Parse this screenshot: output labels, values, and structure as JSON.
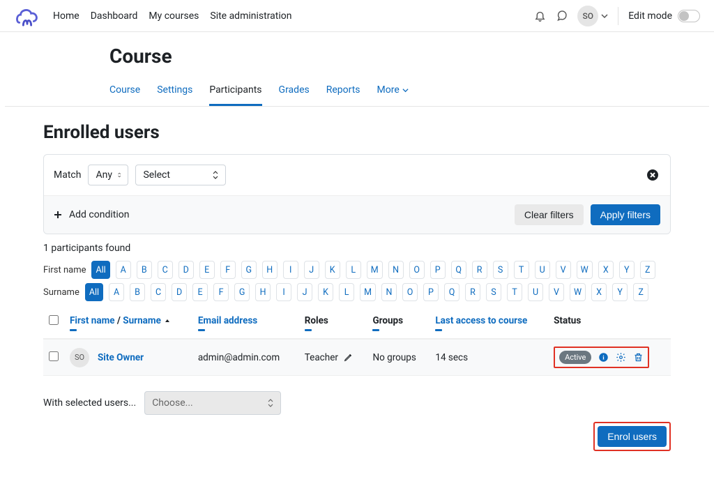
{
  "nav": {
    "home": "Home",
    "dashboard": "Dashboard",
    "mycourses": "My courses",
    "siteadmin": "Site administration"
  },
  "user": {
    "initials": "SO"
  },
  "editmode_label": "Edit mode",
  "course": {
    "title": "Course",
    "tabs": {
      "course": "Course",
      "settings": "Settings",
      "participants": "Participants",
      "grades": "Grades",
      "reports": "Reports",
      "more": "More"
    }
  },
  "page_heading": "Enrolled users",
  "filter": {
    "match_label": "Match",
    "any": "Any",
    "select": "Select",
    "add_condition": "Add condition",
    "clear": "Clear filters",
    "apply": "Apply filters"
  },
  "found": "1 participants found",
  "alpha": {
    "firstname_label": "First name",
    "surname_label": "Surname",
    "all": "All",
    "letters": [
      "A",
      "B",
      "C",
      "D",
      "E",
      "F",
      "G",
      "H",
      "I",
      "J",
      "K",
      "L",
      "M",
      "N",
      "O",
      "P",
      "Q",
      "R",
      "S",
      "T",
      "U",
      "V",
      "W",
      "X",
      "Y",
      "Z"
    ]
  },
  "table": {
    "headers": {
      "firstname": "First name",
      "slash": " / ",
      "surname": "Surname",
      "email": "Email address",
      "roles": "Roles",
      "groups": "Groups",
      "lastaccess": "Last access to course",
      "status": "Status"
    },
    "rows": [
      {
        "initials": "SO",
        "name": "Site Owner",
        "email": "admin@admin.com",
        "role": "Teacher",
        "groups": "No groups",
        "lastaccess": "14 secs",
        "status": "Active"
      }
    ]
  },
  "with_selected": "With selected users...",
  "choose": "Choose...",
  "enrol": "Enrol users"
}
